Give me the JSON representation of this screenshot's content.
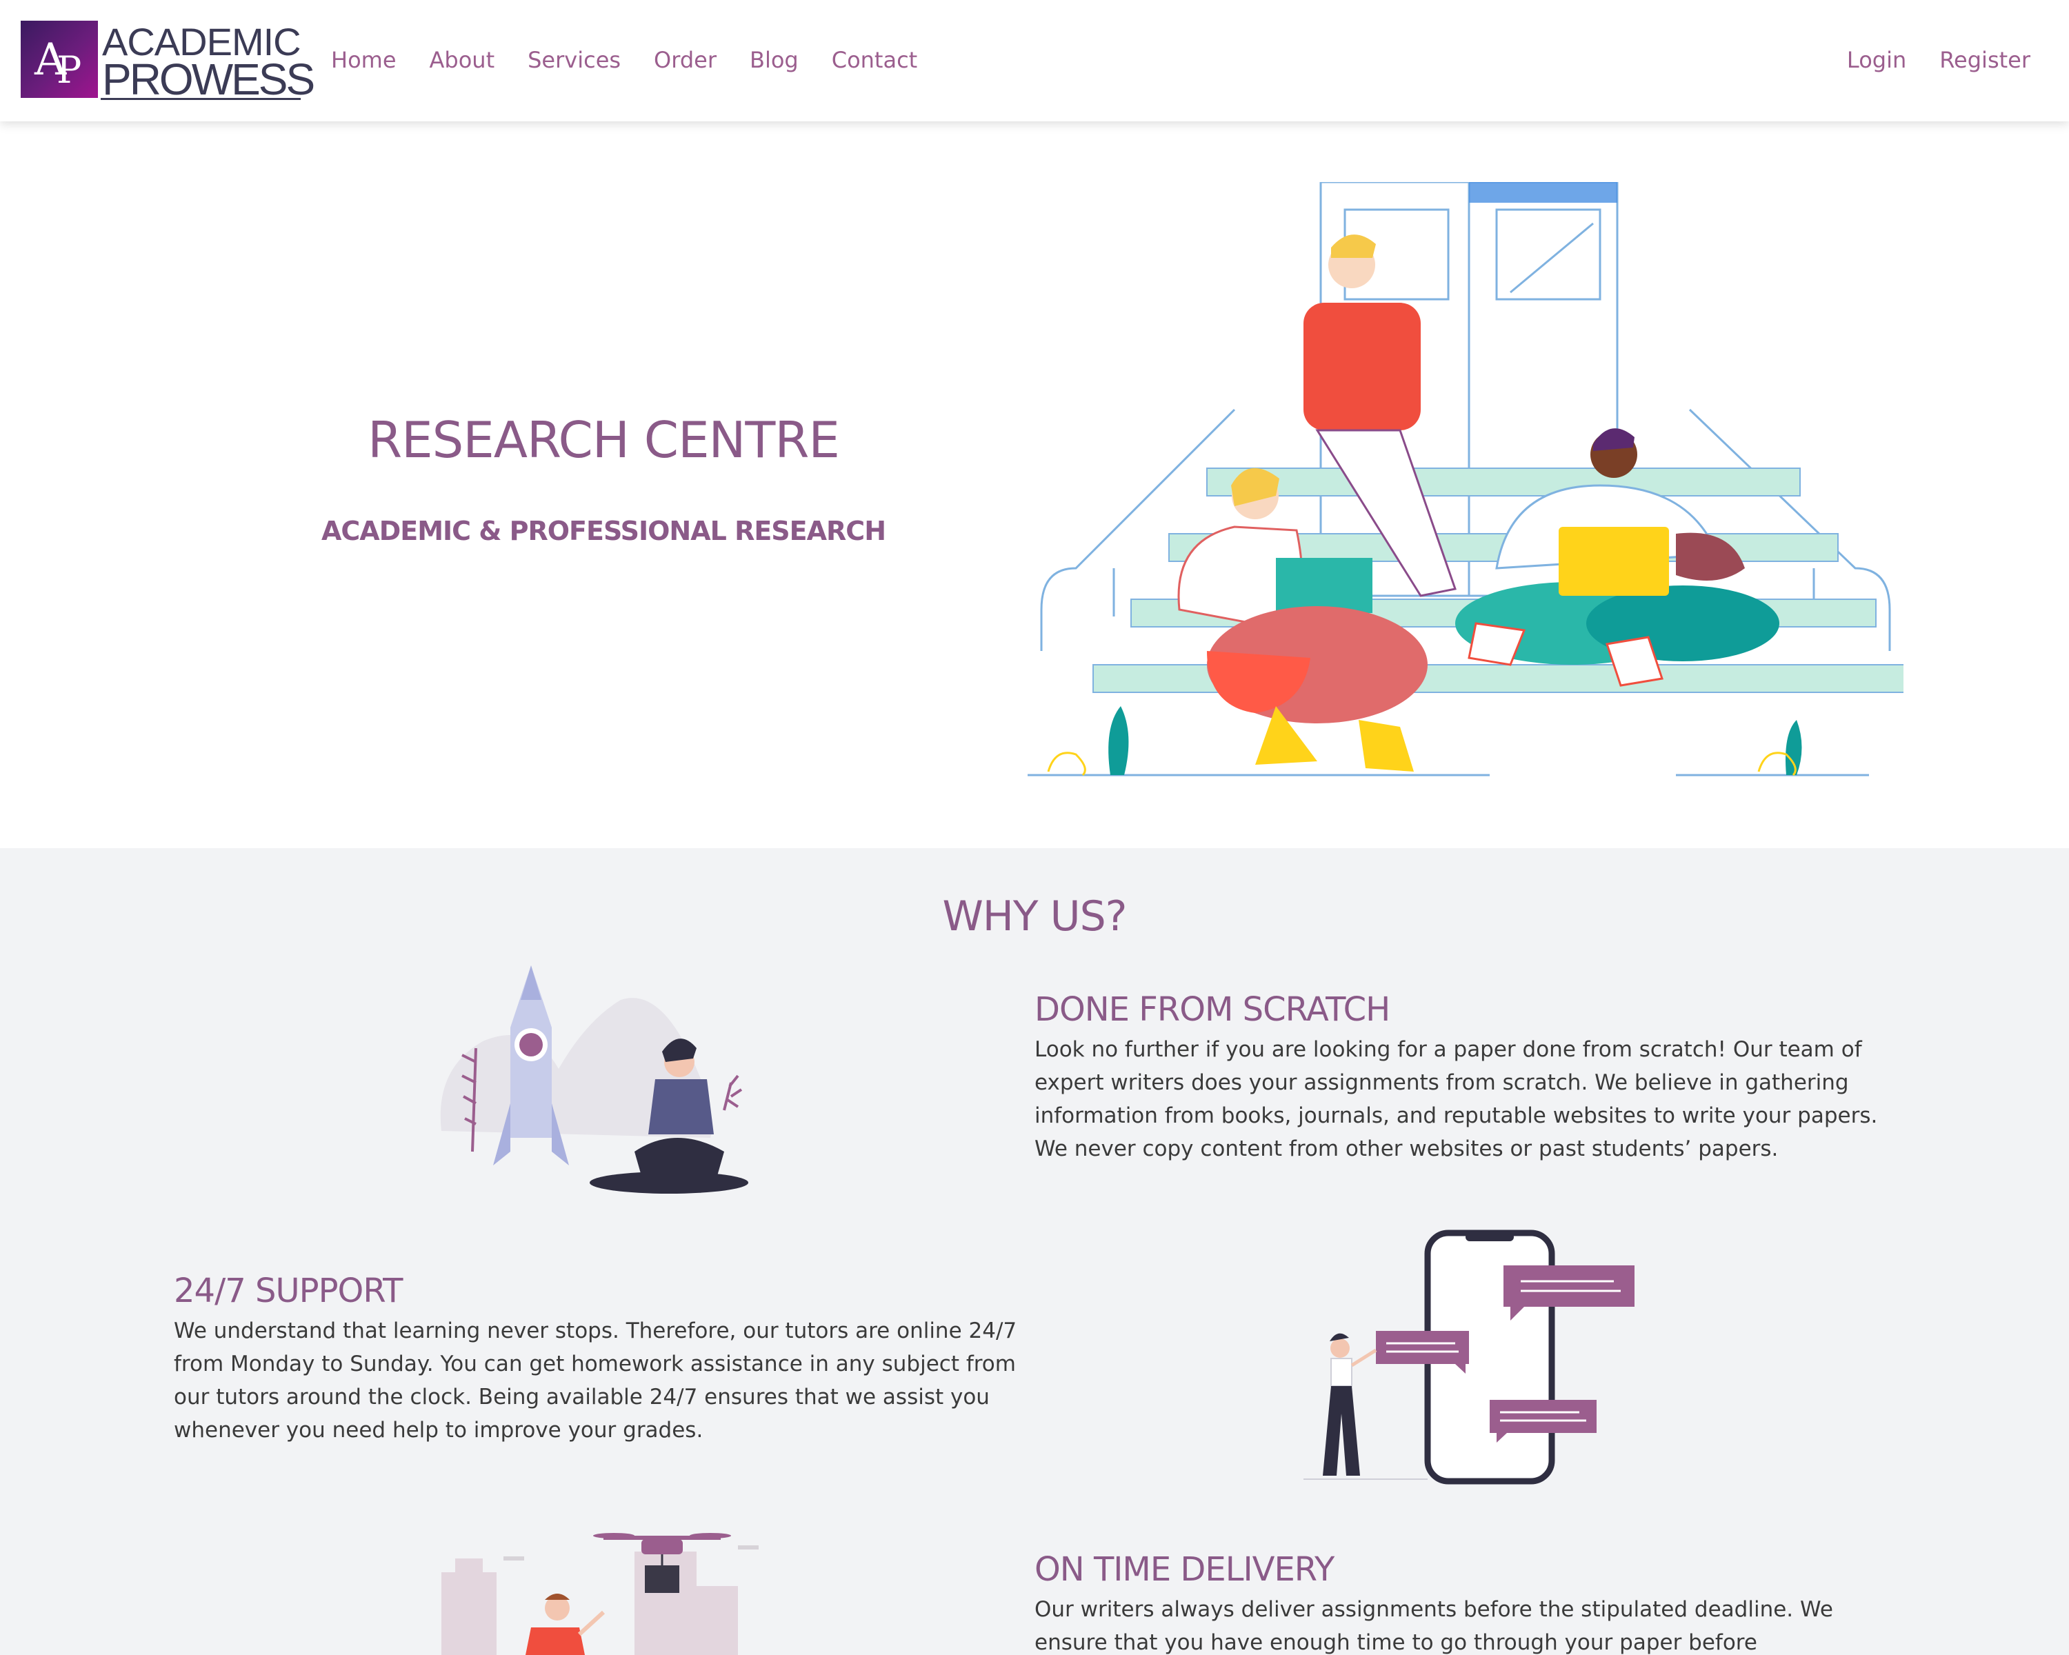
{
  "brand": {
    "logo_initials_1": "A",
    "logo_initials_2": "P",
    "logo_line_1": "ACADEMIC",
    "logo_line_2": "PROWESS"
  },
  "nav": {
    "links": [
      "Home",
      "About",
      "Services",
      "Order",
      "Blog",
      "Contact"
    ],
    "right": [
      "Login",
      "Register"
    ]
  },
  "hero": {
    "title": "RESEARCH CENTRE",
    "subtitle": "ACADEMIC & PROFESSIONAL RESEARCH"
  },
  "why": {
    "title": "WHY US?",
    "features": [
      {
        "heading": "DONE FROM SCRATCH",
        "text": "Look no further if you are looking for a paper done from scratch! Our team of expert writers does your assignments from scratch. We believe in gathering information from books, journals, and reputable websites to write your papers. We never copy content from other websites or past students’ papers."
      },
      {
        "heading": "24/7 SUPPORT",
        "text": "We understand that learning never stops. Therefore, our tutors are online 24/7 from Monday to Sunday. You can get homework assistance in any subject from our tutors around the clock. Being available 24/7 ensures that we assist you whenever you need help to improve your grades."
      },
      {
        "heading": "ON TIME DELIVERY",
        "text": "Our writers always deliver assignments before the stipulated deadline. We ensure that you have enough time to go through your paper before"
      }
    ]
  },
  "colors": {
    "accent": "#8a5a88",
    "nav_link": "#9b5e8e",
    "section_bg": "#f2f3f5",
    "header_bg": "#ffffff"
  },
  "icons": {
    "hero": "students-on-stairs-illustration",
    "feature_1": "rocket-and-person-illustration",
    "feature_2": "phone-chat-illustration",
    "feature_3": "drone-delivery-illustration"
  }
}
